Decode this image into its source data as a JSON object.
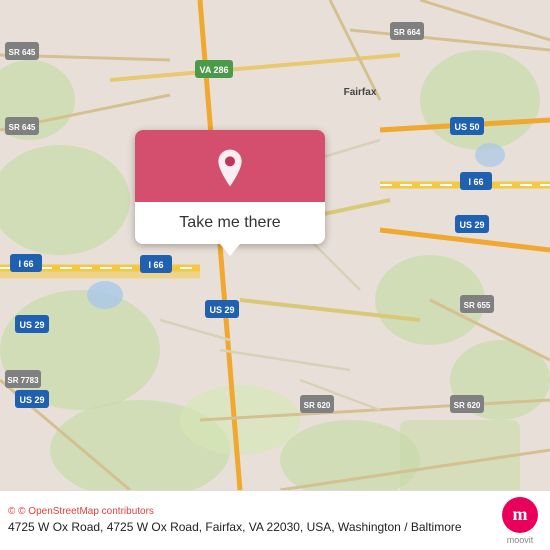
{
  "map": {
    "callout": {
      "button_label": "Take me there"
    },
    "pin_color": "#c0355a"
  },
  "info_bar": {
    "osm_credit": "© OpenStreetMap contributors",
    "address": "4725 W Ox Road, 4725 W Ox Road, Fairfax, VA 22030, USA, Washington / Baltimore",
    "logo_letter": "m",
    "logo_label": "moovit"
  }
}
